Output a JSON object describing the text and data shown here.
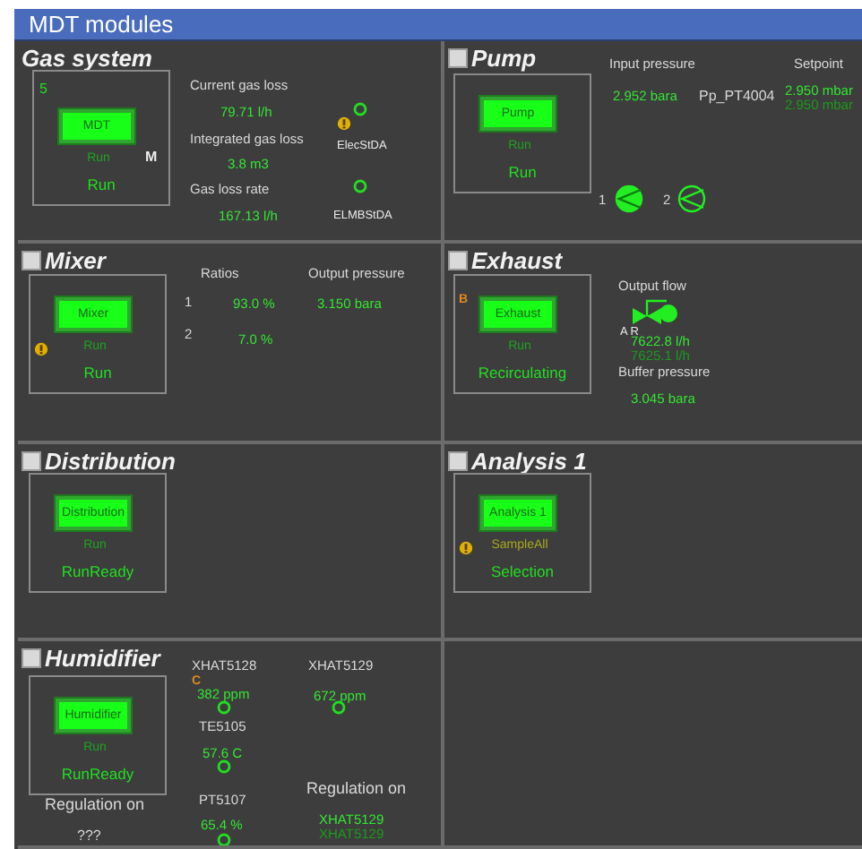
{
  "window": {
    "title": "MDT modules"
  },
  "modules": [
    {
      "kind": "gas",
      "title": "Gas system",
      "faceplate": {
        "counter": "5",
        "label": "MDT",
        "sub": "Run",
        "sub_alert": false,
        "state": "Run",
        "flag": "M",
        "warning": false
      },
      "fields": [
        {
          "kind": "label",
          "text": "Current gas loss"
        },
        {
          "kind": "value",
          "text": "79.71 l/h"
        },
        {
          "kind": "label",
          "text": "Integrated gas loss"
        },
        {
          "kind": "value",
          "text": "3.8 m3"
        },
        {
          "kind": "label",
          "text": "Gas loss rate"
        },
        {
          "kind": "value",
          "text": "167.13 l/h"
        },
        {
          "kind": "led",
          "on": false
        },
        {
          "kind": "warning"
        },
        {
          "kind": "tag",
          "text": "ElecStDA"
        },
        {
          "kind": "led",
          "on": false
        },
        {
          "kind": "tag",
          "text": "ELMBStDA"
        }
      ]
    },
    {
      "kind": "pump",
      "title": "Pump",
      "checked": false,
      "faceplate": {
        "label": "Pump",
        "sub": "Run",
        "sub_alert": false,
        "state": "Run",
        "warning": false
      },
      "fields": [
        {
          "kind": "label",
          "text": "Input pressure"
        },
        {
          "kind": "label",
          "text": "Setpoint"
        },
        {
          "kind": "value",
          "text": "2.952 bara"
        },
        {
          "kind": "plain",
          "text": "Pp_PT4004"
        },
        {
          "kind": "value",
          "text": "2.950 mbar"
        },
        {
          "kind": "dim",
          "text": "2.950 mbar"
        },
        {
          "kind": "label",
          "text": "1"
        },
        {
          "kind": "pump",
          "running": true
        },
        {
          "kind": "label",
          "text": "2"
        },
        {
          "kind": "pump",
          "running": false
        }
      ]
    },
    {
      "kind": "mixer",
      "title": "Mixer",
      "checked": false,
      "faceplate": {
        "label": "Mixer",
        "sub": "Run",
        "sub_alert": false,
        "state": "Run",
        "warning": true
      },
      "fields": [
        {
          "kind": "label",
          "text": "Ratios"
        },
        {
          "kind": "label",
          "text": "Output pressure"
        },
        {
          "kind": "label",
          "text": "1"
        },
        {
          "kind": "value",
          "text": "93.0 %"
        },
        {
          "kind": "value",
          "text": "3.150 bara"
        },
        {
          "kind": "label",
          "text": "2"
        },
        {
          "kind": "value",
          "text": "7.0 %"
        }
      ]
    },
    {
      "kind": "exhaust",
      "title": "Exhaust",
      "checked": false,
      "faceplate": {
        "marker": "B",
        "label": "Exhaust",
        "sub": "Run",
        "sub_alert": false,
        "state": "Recirculating",
        "warning": false
      },
      "fields": [
        {
          "kind": "label",
          "text": "Output flow"
        },
        {
          "kind": "valve"
        },
        {
          "kind": "tag",
          "text": "A R"
        },
        {
          "kind": "value",
          "text": "7622.8 l/h"
        },
        {
          "kind": "dim",
          "text": "7625.1 l/h"
        },
        {
          "kind": "label",
          "text": "Buffer pressure"
        },
        {
          "kind": "value",
          "text": "3.045 bara"
        }
      ]
    },
    {
      "kind": "distribution",
      "title": "Distribution",
      "checked": false,
      "faceplate": {
        "label": "Distribution",
        "sub": "Run",
        "sub_alert": false,
        "state": "RunReady",
        "warning": false
      }
    },
    {
      "kind": "analysis",
      "title": "Analysis 1",
      "checked": false,
      "faceplate": {
        "label": "Analysis 1",
        "sub": "SampleAll",
        "sub_alert": true,
        "state": "Selection",
        "warning": true
      }
    },
    {
      "kind": "humidifier",
      "title": "Humidifier",
      "checked": false,
      "faceplate": {
        "label": "Humidifier",
        "sub": "Run",
        "sub_alert": false,
        "state": "RunReady",
        "warning": false
      },
      "fields": [
        {
          "kind": "label",
          "text": "XHAT5128"
        },
        {
          "kind": "marker",
          "text": "C"
        },
        {
          "kind": "value",
          "text": "382 ppm"
        },
        {
          "kind": "led",
          "on": false
        },
        {
          "kind": "label",
          "text": "TE5105"
        },
        {
          "kind": "value",
          "text": "57.6 C"
        },
        {
          "kind": "led",
          "on": false
        },
        {
          "kind": "label",
          "text": "PT5107"
        },
        {
          "kind": "value",
          "text": "65.4 %"
        },
        {
          "kind": "led",
          "on": false
        },
        {
          "kind": "label",
          "text": "XHAT5129"
        },
        {
          "kind": "value",
          "text": "672 ppm"
        },
        {
          "kind": "led",
          "on": false
        },
        {
          "kind": "big",
          "text": "Regulation on"
        },
        {
          "kind": "value",
          "text": "XHAT5129"
        },
        {
          "kind": "dim",
          "text": "XHAT5129"
        },
        {
          "kind": "big",
          "text": "Regulation on"
        },
        {
          "kind": "plain",
          "text": "???"
        }
      ]
    },
    {
      "kind": "empty"
    }
  ]
}
